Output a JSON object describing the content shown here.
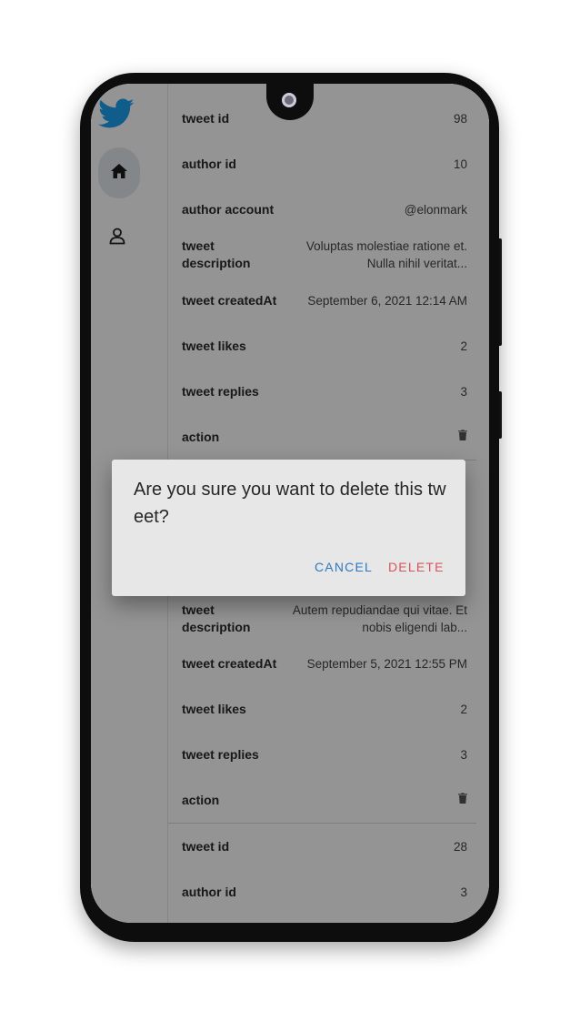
{
  "sidebar": {
    "logo_icon": "twitter-bird-icon",
    "home_icon": "home-icon",
    "profile_icon": "person-icon",
    "brand_color": "#1da1f2"
  },
  "tweets": [
    {
      "rows": [
        {
          "label": "tweet id",
          "value": "98"
        },
        {
          "label": "author id",
          "value": "10"
        },
        {
          "label": "author account",
          "value": "@elonmark"
        },
        {
          "label": "tweet description",
          "value": "Voluptas molestiae ratione et. Nulla nihil veritat..."
        },
        {
          "label": "tweet createdAt",
          "value": "September 6, 2021 12:14 AM"
        },
        {
          "label": "tweet likes",
          "value": "2"
        },
        {
          "label": "tweet replies",
          "value": "3"
        },
        {
          "label": "action",
          "value": "trash-icon"
        }
      ]
    },
    {
      "rows": [
        {
          "label": "tweet description",
          "value": "Autem repudiandae qui vitae. Et nobis eligendi lab..."
        },
        {
          "label": "tweet createdAt",
          "value": "September 5, 2021 12:55 PM"
        },
        {
          "label": "tweet likes",
          "value": "2"
        },
        {
          "label": "tweet replies",
          "value": "3"
        },
        {
          "label": "action",
          "value": "trash-icon"
        }
      ]
    },
    {
      "rows": [
        {
          "label": "tweet id",
          "value": "28"
        },
        {
          "label": "author id",
          "value": "3"
        }
      ]
    }
  ],
  "dialog": {
    "title": "Are you sure you want to delete this tweet?",
    "cancel_label": "CANCEL",
    "delete_label": "DELETE",
    "cancel_color": "#2f77c4",
    "delete_color": "#d5565c"
  }
}
